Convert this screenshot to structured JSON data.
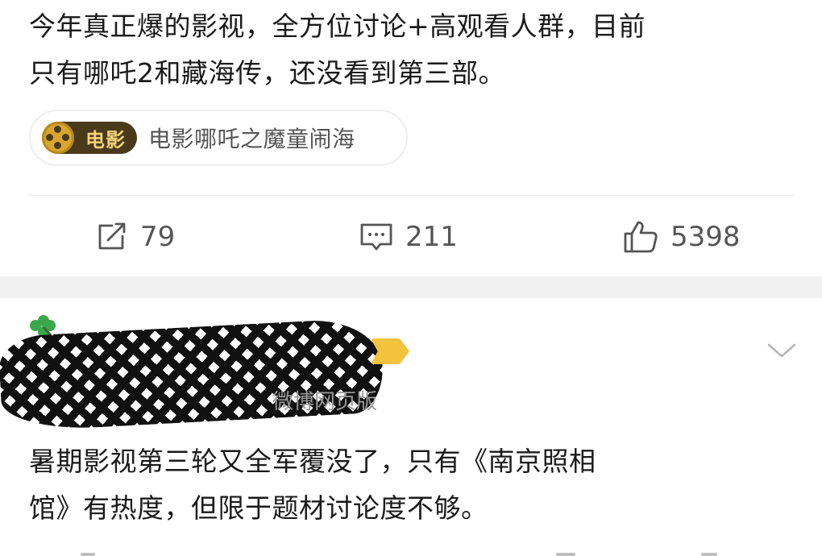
{
  "post1": {
    "text_line1": "今年真正爆的影视，全方位讨论+高观看人群，目前",
    "text_line2": "只有哪吒2和藏海传，还没看到第三部。",
    "movie_chip": {
      "badge_label": "电影",
      "title": "电影哪吒之魔童闹海",
      "badge_color": "#4a3a1c",
      "badge_text_color": "#f3d27a"
    },
    "actions": {
      "repost_count": "79",
      "comment_count": "211",
      "like_count": "5398"
    }
  },
  "post2": {
    "source": "微博网页版",
    "text_line1": "暑期影视第三轮又全军覆没了，只有《南京照相",
    "text_line2": "馆》有热度，但限于题材讨论度不够。"
  },
  "icons": {
    "repost": "repost-icon",
    "comment": "comment-icon",
    "like": "like-icon",
    "expand": "chevron-down-icon",
    "clover": "clover-icon"
  },
  "colors": {
    "text": "#1a1a1a",
    "muted": "#555555",
    "source": "#9a9a9a",
    "separator": "#f1f1f1"
  }
}
